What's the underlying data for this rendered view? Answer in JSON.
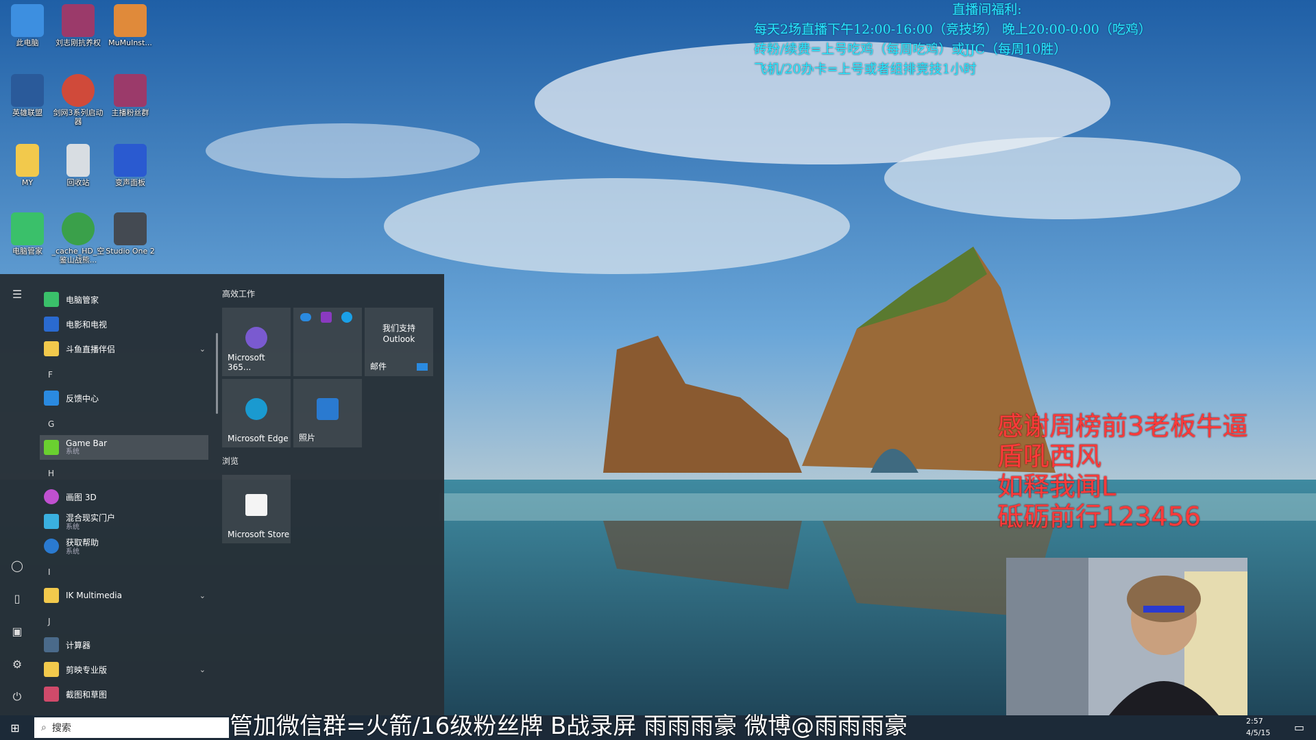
{
  "desktop": {
    "icons": [
      {
        "label": "此电脑",
        "icon": "computer-icon",
        "color": "#3d8fe0"
      },
      {
        "label": "刘志刚抗养权",
        "icon": "winrar-icon",
        "color": "#9b3a6a"
      },
      {
        "label": "MuMuInst...",
        "icon": "package-icon",
        "color": "#e08a3a"
      },
      {
        "label": "英雄联盟",
        "icon": "game-icon",
        "color": "#2a5a9a"
      },
      {
        "label": "剑网3系列启动器",
        "icon": "game-launcher-icon",
        "color": "#d04a3a"
      },
      {
        "label": "主播粉丝群",
        "icon": "winrar-icon",
        "color": "#9b3a6a"
      },
      {
        "label": "MY",
        "icon": "folder-icon",
        "color": "#f2c94c"
      },
      {
        "label": "回收站",
        "icon": "recycle-bin-icon",
        "color": "#d8dde2"
      },
      {
        "label": "变声面板",
        "icon": "audio-icon",
        "color": "#2a5ad0"
      },
      {
        "label": "电脑管家",
        "icon": "pc-manager-icon",
        "color": "#3ac06a"
      },
      {
        "label": "_cache_HD_空鉴山战熊...",
        "icon": "shortcut-icon",
        "color": "#3aa04a"
      },
      {
        "label": "Studio One 2",
        "icon": "studio-icon",
        "color": "#444a52"
      }
    ]
  },
  "overlay": {
    "line1": "直播间福利:",
    "line2": "每天2场直播下午12:00-16:00（竞技场） 晚上20:00-0:00（吃鸡）",
    "line3": "砖粉/续费=上号吃鸡（每周吃鸡）或JJC（每周10胜）",
    "line4": "飞机/20办卡=上号或者组排竞技1小时",
    "thanks": [
      "感谢周榜前3老板牛逼",
      "盾吼西风",
      "如释我闻L",
      "砥砺前行123456"
    ],
    "ticker": "管加微信群=火箭/16级粉丝牌 B战录屏 雨雨雨豪 微博@雨雨雨豪"
  },
  "start_menu": {
    "apps": [
      {
        "kind": "app",
        "label": "电脑管家",
        "sub": "",
        "color": "#3ac06a",
        "icon": "pc-manager-icon"
      },
      {
        "kind": "app",
        "label": "电影和电视",
        "sub": "",
        "color": "#2a6ad0",
        "icon": "film-icon"
      },
      {
        "kind": "folder",
        "label": "斗鱼直播伴侣",
        "sub": "",
        "color": "#f2c94c",
        "icon": "folder-icon"
      },
      {
        "kind": "letter",
        "label": "F"
      },
      {
        "kind": "app",
        "label": "反馈中心",
        "sub": "",
        "color": "#2a8ae0",
        "icon": "feedback-icon"
      },
      {
        "kind": "letter",
        "label": "G"
      },
      {
        "kind": "app",
        "label": "Game Bar",
        "sub": "系统",
        "color": "#6ad030",
        "icon": "game-bar-icon",
        "highlight": true
      },
      {
        "kind": "letter",
        "label": "H"
      },
      {
        "kind": "app",
        "label": "画图 3D",
        "sub": "",
        "color": "#c050d0",
        "icon": "paint3d-icon"
      },
      {
        "kind": "app",
        "label": "混合现实门户",
        "sub": "系统",
        "color": "#3ab0e0",
        "icon": "mixed-reality-icon"
      },
      {
        "kind": "app",
        "label": "获取帮助",
        "sub": "系统",
        "color": "#2a7ad0",
        "icon": "help-icon"
      },
      {
        "kind": "letter",
        "label": "I"
      },
      {
        "kind": "folder",
        "label": "IK Multimedia",
        "sub": "",
        "color": "#f2c94c",
        "icon": "folder-icon"
      },
      {
        "kind": "letter",
        "label": "J"
      },
      {
        "kind": "app",
        "label": "计算器",
        "sub": "",
        "color": "#4a6a8a",
        "icon": "calculator-icon"
      },
      {
        "kind": "folder",
        "label": "剪映专业版",
        "sub": "",
        "color": "#f2c94c",
        "icon": "folder-icon"
      },
      {
        "kind": "app",
        "label": "截图和草图",
        "sub": "",
        "color": "#d04a6a",
        "icon": "snip-icon"
      }
    ],
    "group1_title": "高效工作",
    "group2_title": "浏览",
    "tiles": {
      "m365": "Microsoft 365...",
      "outlook_top": "我们支持",
      "outlook_bottom": "Outlook",
      "mail": "邮件",
      "edge": "Microsoft Edge",
      "photos": "照片",
      "store": "Microsoft Store"
    }
  },
  "taskbar": {
    "search_placeholder": "搜索",
    "time": "2:57",
    "date": "4/5/15"
  }
}
